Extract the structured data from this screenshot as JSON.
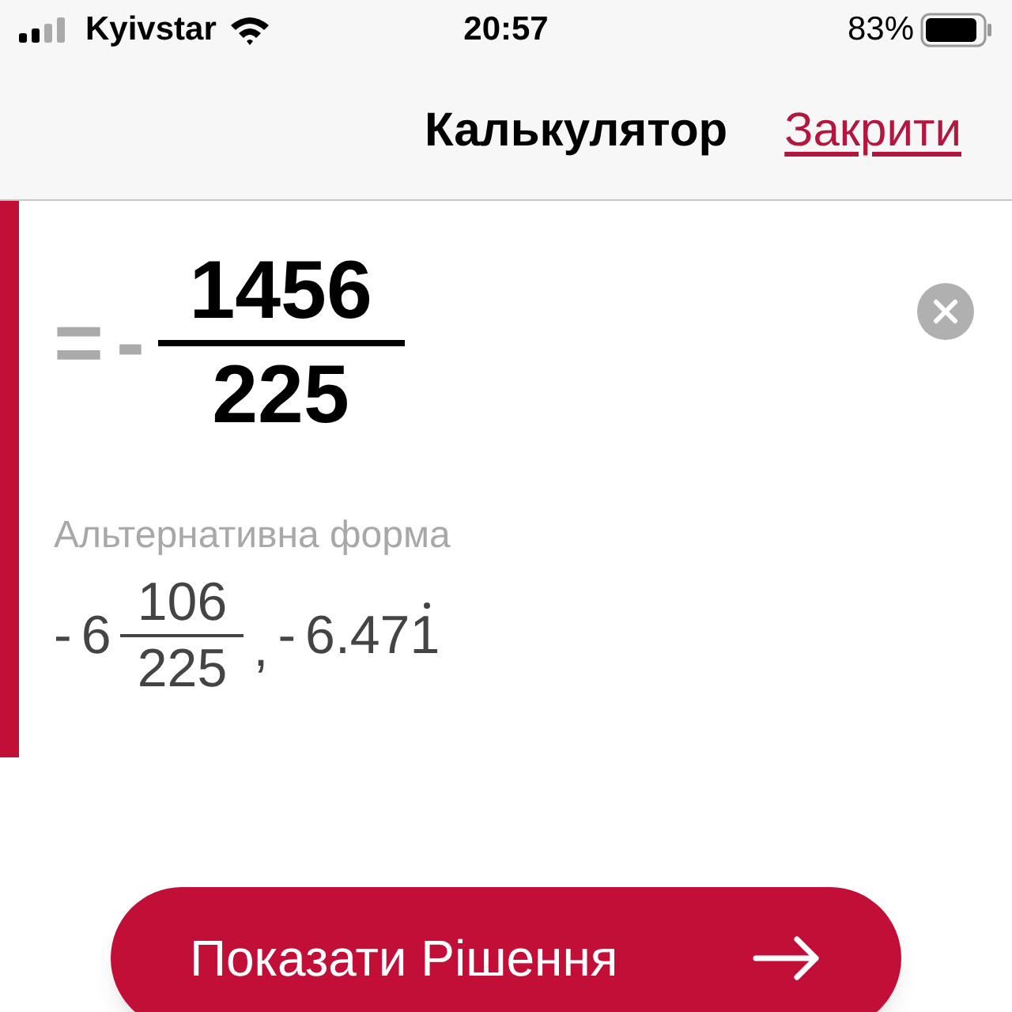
{
  "status_bar": {
    "carrier": "Kyivstar",
    "time": "20:57",
    "battery": "83%"
  },
  "nav": {
    "title": "Калькулятор",
    "close": "Закрити"
  },
  "result": {
    "equals": "=",
    "sign": "-",
    "numerator": "1456",
    "denominator": "225"
  },
  "alternative": {
    "label": "Альтернативна форма",
    "mixed": {
      "sign": "-",
      "whole": "6",
      "numerator": "106",
      "denominator": "225"
    },
    "separator": ",",
    "decimal": {
      "sign": "-",
      "digits": "6.47",
      "repeating": "1"
    }
  },
  "button": {
    "label": "Показати Рішення"
  }
}
